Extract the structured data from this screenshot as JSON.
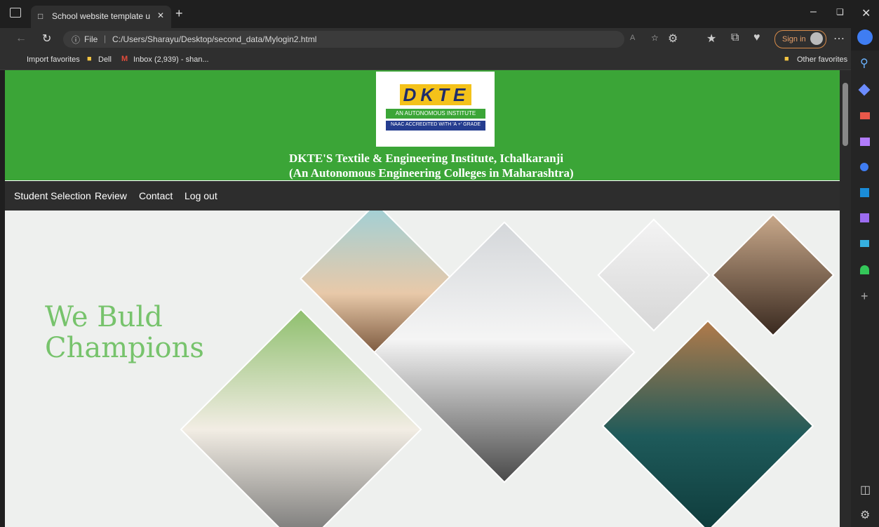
{
  "browser": {
    "tab_title": "School website template using p",
    "address_prefix": "File",
    "address_url": "C:/Users/Sharayu/Desktop/second_data/Mylogin2.html",
    "sign_in": "Sign in",
    "favorites": [
      "Import favorites",
      "Dell",
      "Inbox (2,939) - shan..."
    ],
    "other_favorites": "Other favorites"
  },
  "header": {
    "logo_text": "DKTE",
    "logo_sub1": "AN AUTONOMOUS INSTITUTE",
    "logo_sub2": "NAAC ACCREDITED WITH 'A +' GRADE",
    "title_line1": "DKTE'S Textile & Engineering Institute, Ichalkaranji",
    "title_line2": "(An Autonomous Engineering Colleges in Maharashtra)"
  },
  "nav": {
    "items": [
      "Student Selection",
      "Review",
      "Contact",
      "Log out"
    ]
  },
  "hero": {
    "line1": "We Buld",
    "line2": "Champions"
  },
  "colors": {
    "header_green": "#3ba537",
    "nav_dark": "#2d2d2d",
    "hero_text": "#77c36c"
  }
}
